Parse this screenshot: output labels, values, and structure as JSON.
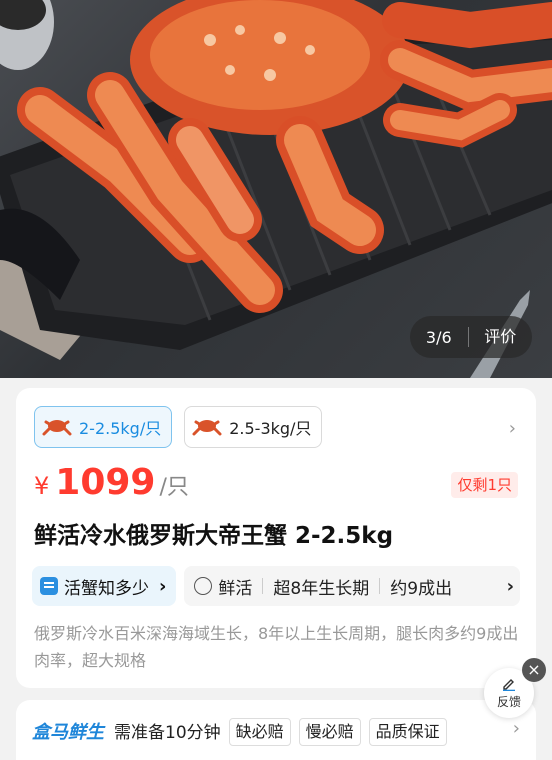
{
  "gallery": {
    "index": "3/6",
    "reviews_label": "评价"
  },
  "specs": [
    {
      "label": "2-2.5kg/只",
      "selected": true
    },
    {
      "label": "2.5-3kg/只",
      "selected": false
    }
  ],
  "price": {
    "symbol": "¥",
    "amount": "1099",
    "unit": "/只",
    "stock_badge": "仅剩1只"
  },
  "product": {
    "title": "鲜活冷水俄罗斯大帝王蟹 2-2.5kg",
    "description": "俄罗斯冷水百米深海海域生长，8年以上生长周期，腿长肉多约9成出肉率，超大规格"
  },
  "tags": {
    "knowledge_label": "活蟹知多少",
    "features": [
      "鲜活",
      "超8年生长期",
      "约9成出"
    ]
  },
  "delivery": {
    "brand": "盒马鲜生",
    "prep_text": "需准备10分钟",
    "promises": [
      "缺必赔",
      "慢必赔",
      "品质保证"
    ]
  },
  "feedback": {
    "label": "反馈"
  },
  "colors": {
    "price_red": "#ff3b2f",
    "accent_blue": "#1a8ce0",
    "brand_blue": "#1f86d9"
  }
}
